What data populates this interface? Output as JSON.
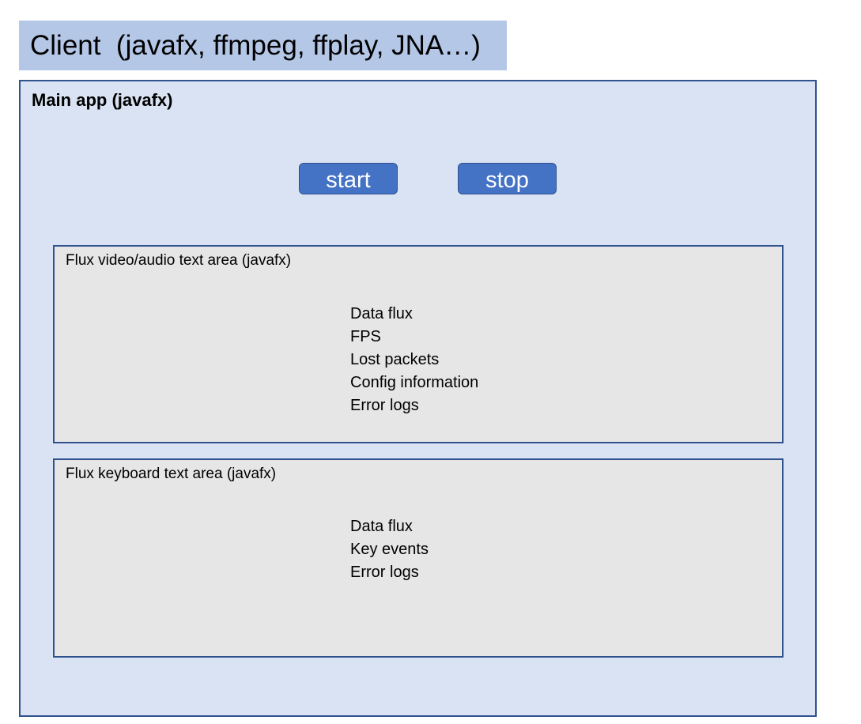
{
  "client": {
    "title": "Client  (javafx, ffmpeg, ffplay, JNA…)"
  },
  "main_app": {
    "title": "Main app (javafx)",
    "buttons": {
      "start_label": "start",
      "stop_label": "stop"
    },
    "text_areas": [
      {
        "title": "Flux video/audio text area (javafx)",
        "lines": [
          "Data flux",
          "FPS",
          "Lost packets",
          "Config information",
          "Error logs"
        ]
      },
      {
        "title": "Flux keyboard text area (javafx)",
        "lines": [
          "Data flux",
          "Key events",
          "Error logs"
        ]
      }
    ]
  },
  "colors": {
    "client_banner": "#b4c7e7",
    "main_app_fill": "#dae3f3",
    "border": "#2f528f",
    "button_fill": "#4472c4",
    "text_area_fill": "#e7e6e6"
  }
}
